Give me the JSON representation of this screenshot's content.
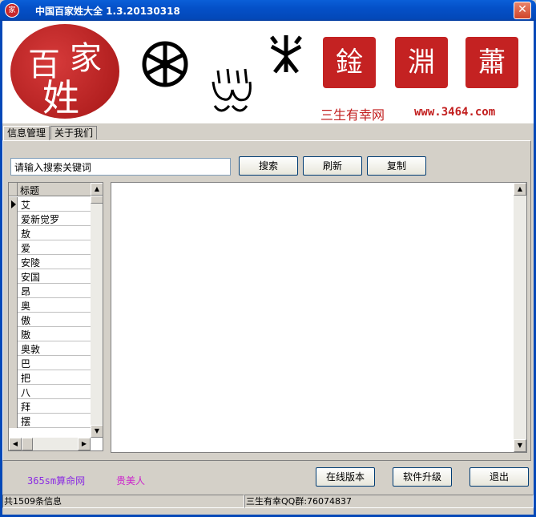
{
  "window": {
    "title": "中国百家姓大全 1.3.20130318",
    "close": "✕"
  },
  "banner": {
    "seal_chars": [
      "百",
      "家",
      "姓"
    ],
    "slogan": "三生有幸网",
    "url": "www.3464.com"
  },
  "tabs": [
    {
      "label": "信息管理"
    },
    {
      "label": "关于我们"
    }
  ],
  "search": {
    "placeholder": "请输入搜索关键词",
    "search_label": "搜索",
    "refresh_label": "刷新",
    "copy_label": "复制"
  },
  "grid": {
    "header": "标题",
    "rows": [
      "艾",
      "爱新觉罗",
      "敖",
      "爱",
      "安陵",
      "安国",
      "昂",
      "奥",
      "傲",
      "隞",
      "奥敦",
      "巴",
      "把",
      "八",
      "拜",
      "摆"
    ]
  },
  "footer": {
    "link1": "365sm算命网",
    "link2": "贵美人",
    "online_label": "在线版本",
    "upgrade_label": "软件升级",
    "exit_label": "退出"
  },
  "status": {
    "count": "共1509条信息",
    "qq": "三生有幸QQ群:76074837"
  },
  "colors": {
    "title_bar": "#0450c8",
    "accent_red": "#c21f1f",
    "link1": "#8a2be2",
    "link2": "#cc22cc"
  }
}
